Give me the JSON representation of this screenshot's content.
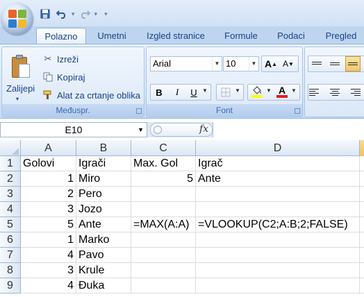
{
  "quick_access": {
    "save_icon": "save-icon",
    "undo_icon": "undo-icon",
    "redo_icon": "redo-icon",
    "customize_icon": "customize-qat-icon"
  },
  "tabs": [
    {
      "label": "Polazno",
      "active": true
    },
    {
      "label": "Umetni",
      "active": false
    },
    {
      "label": "Izgled stranice",
      "active": false
    },
    {
      "label": "Formule",
      "active": false
    },
    {
      "label": "Podaci",
      "active": false
    },
    {
      "label": "Pregled",
      "active": false
    }
  ],
  "clipboard": {
    "paste_label": "Zalijepi",
    "cut_label": "Izreži",
    "copy_label": "Kopiraj",
    "format_painter_label": "Alat za crtanje oblika",
    "group_label": "Međuspr."
  },
  "font": {
    "font_name": "Arial",
    "font_size": "10",
    "bold": "B",
    "italic": "I",
    "underline": "U",
    "font_color": "A",
    "grow": "A",
    "shrink": "A",
    "group_label": "Font",
    "accent_font_color": "#e02020",
    "accent_highlight": "#ffff00"
  },
  "formula_bar": {
    "name_box": "E10",
    "fx": "fx",
    "formula": ""
  },
  "sheet": {
    "columns": [
      "A",
      "B",
      "C",
      "D"
    ],
    "rows": [
      {
        "num": "1",
        "A": "Golovi",
        "B": "Igrači",
        "C": "Max. Gol",
        "D": "Igrač"
      },
      {
        "num": "2",
        "A": "1",
        "B": "Miro",
        "C": "5",
        "D": "Ante"
      },
      {
        "num": "3",
        "A": "2",
        "B": "Pero",
        "C": "",
        "D": ""
      },
      {
        "num": "4",
        "A": "3",
        "B": "Jozo",
        "C": "",
        "D": ""
      },
      {
        "num": "5",
        "A": "5",
        "B": "Ante",
        "C": "=MAX(A:A)",
        "D": "=VLOOKUP(C2;A:B;2;FALSE)"
      },
      {
        "num": "6",
        "A": "1",
        "B": "Marko",
        "C": "",
        "D": ""
      },
      {
        "num": "7",
        "A": "4",
        "B": "Pavo",
        "C": "",
        "D": ""
      },
      {
        "num": "8",
        "A": "3",
        "B": "Krule",
        "C": "",
        "D": ""
      },
      {
        "num": "9",
        "A": "4",
        "B": "Đuka",
        "C": "",
        "D": ""
      }
    ]
  }
}
